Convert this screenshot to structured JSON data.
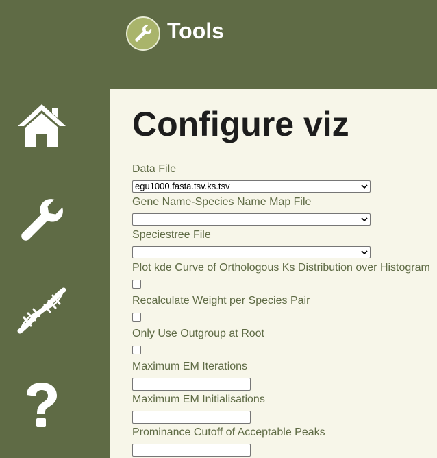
{
  "header": {
    "title": "Tools",
    "logo_icon": "wrench-icon"
  },
  "sidebar": {
    "items": [
      {
        "name": "home",
        "icon": "home-icon"
      },
      {
        "name": "tools",
        "icon": "wrench-icon"
      },
      {
        "name": "dna",
        "icon": "dna-icon"
      },
      {
        "name": "help",
        "icon": "question-icon"
      }
    ]
  },
  "main": {
    "title": "Configure viz",
    "fields": {
      "data_file": {
        "label": "Data File",
        "value": "egu1000.fasta.tsv.ks.tsv"
      },
      "gene_map": {
        "label": "Gene Name-Species Name Map File",
        "value": ""
      },
      "speciestree": {
        "label": "Speciestree File",
        "value": ""
      },
      "plot_kde": {
        "label": "Plot kde Curve of Orthologous Ks Distribution over Histogram",
        "checked": false
      },
      "recalc_weight": {
        "label": "Recalculate Weight per Species Pair",
        "checked": false
      },
      "outgroup_root": {
        "label": "Only Use Outgroup at Root",
        "checked": false
      },
      "max_em_iter": {
        "label": "Maximum EM Iterations",
        "value": ""
      },
      "max_em_init": {
        "label": "Maximum EM Initialisations",
        "value": ""
      },
      "prominence": {
        "label": "Prominance Cutoff of Acceptable Peaks",
        "value": ""
      }
    }
  },
  "colors": {
    "sidebar_bg": "#5f6b45",
    "content_bg": "#f7f6e9",
    "label_text": "#5f6b45",
    "logo_bg": "#a9b46b"
  }
}
